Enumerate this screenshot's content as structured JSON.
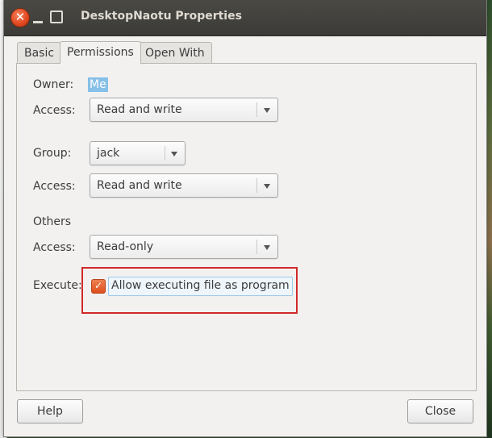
{
  "window": {
    "title": "DesktopNaotu Properties"
  },
  "tabs": [
    {
      "label": "Basic"
    },
    {
      "label": "Permissions"
    },
    {
      "label": "Open With"
    }
  ],
  "active_tab": "Permissions",
  "permissions": {
    "owner_label": "Owner:",
    "owner_value": "Me",
    "owner_access_label": "Access:",
    "owner_access_value": "Read and write",
    "group_label": "Group:",
    "group_value": "jack",
    "group_access_label": "Access:",
    "group_access_value": "Read and write",
    "others_heading": "Others",
    "others_access_label": "Access:",
    "others_access_value": "Read-only",
    "execute_label": "Execute:",
    "execute_checkbox_label": "Allow executing file as program",
    "execute_checked": true
  },
  "buttons": {
    "help": "Help",
    "close": "Close"
  },
  "icons": {
    "close": "close-icon",
    "minimize": "minimize-icon",
    "maximize": "maximize-icon",
    "dropdown": "chevron-down-icon",
    "check": "checkmark-icon"
  },
  "colors": {
    "accent": "#dd4f1f",
    "highlight_box": "#d32828",
    "selection": "#86bfe8"
  }
}
